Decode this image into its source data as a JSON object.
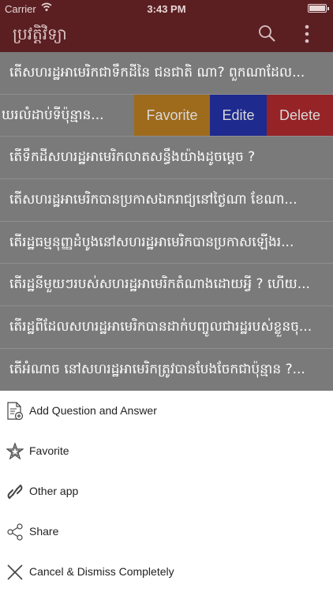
{
  "status_bar": {
    "carrier": "Carrier",
    "time": "3:43 PM",
    "battery_level": 0.9
  },
  "navbar": {
    "title": "ប្រវត្តិវិទ្យា"
  },
  "list": {
    "rows": [
      "តើសហរដ្ឋអាមេរិកជាទឹកដីនៃ  ជនជាតិ ណា? ពួកណាដែល...",
      "ឃរលំដាប់ទីប៉ុន្មាន...",
      "តើទឹកដីសហរដ្ឋអាមេរិកលាតសន្ធឹងយ៉ាងដូចម្តេច ?",
      "តើសហរដ្ឋអាមេរិកបានប្រកាសឯករាជ្យនៅថ្ងៃណា  ខែណា...",
      "តើរដ្ឋធម្មនុញ្ញដំបូងនៅសហរដ្ឋអាមេរិកបានប្រកាសឡើងរ...",
      "តើរដ្ឋនីមួយៗរបស់សហរដ្ឋអាមេរិកតំណាងដោយអ្វី ? ហើយ...",
      "តើរដ្ឋពីដែលសហរដ្ឋអាមេរិកបានដាក់បញ្ចូលជារដ្ឋរបស់ខ្លួនចុ...",
      "តើអំណាច  នៅសហរដ្ឋអាមេរិកត្រូវបានបែងចែកជាប៉ុន្មាន  ?..."
    ],
    "swipe_actions": {
      "favorite": "Favorite",
      "edit": "Edite",
      "delete": "Delete"
    }
  },
  "sheet": {
    "items": [
      {
        "label": "Add Question and Answer",
        "icon": "add-document-icon"
      },
      {
        "label": "Favorite",
        "icon": "star-icon"
      },
      {
        "label": "Other app",
        "icon": "link-icon"
      },
      {
        "label": "Share",
        "icon": "share-icon"
      },
      {
        "label": "Cancel & Dismiss Completely",
        "icon": "close-icon"
      }
    ]
  },
  "colors": {
    "navbar": "#5b1f22",
    "favorite": "#9e6a1c",
    "edit": "#1e2a8e",
    "delete": "#962326"
  }
}
